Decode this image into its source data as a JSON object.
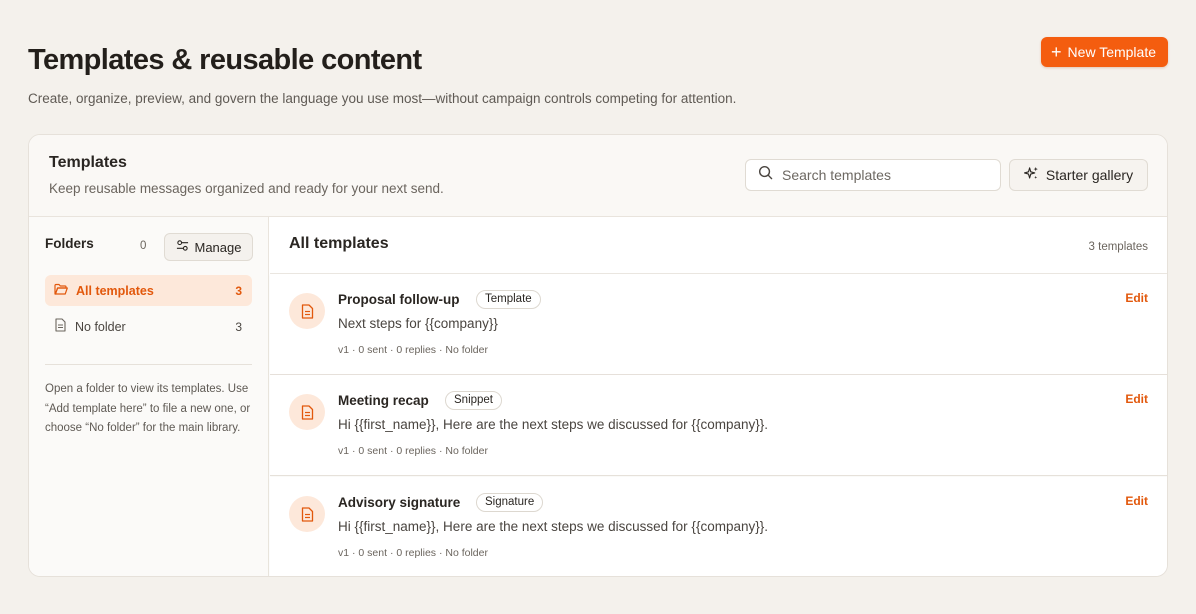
{
  "header": {
    "title": "Templates & reusable content",
    "subtitle": "Create, organize, preview, and govern the language you use most—without campaign controls competing for attention.",
    "new_button": "New Template"
  },
  "card": {
    "title": "Templates",
    "description": "Keep reusable messages organized and ready for your next send.",
    "search_placeholder": "Search templates",
    "starter_gallery": "Starter gallery"
  },
  "sidebar": {
    "folders_label": "Folders",
    "folders_count": "0",
    "manage_label": "Manage",
    "items": [
      {
        "label": "All templates",
        "count": "3",
        "active": true,
        "icon": "folder-open-icon"
      },
      {
        "label": "No folder",
        "count": "3",
        "active": false,
        "icon": "document-icon"
      }
    ],
    "help_text": "Open a folder to view its templates. Use “Add template here” to file a new one, or choose “No folder” for the main library."
  },
  "main": {
    "title": "All templates",
    "count_label": "3 templates",
    "templates": [
      {
        "name": "Proposal follow-up",
        "type": "Template",
        "preview": "Next steps for {{company}}",
        "meta": "v1 · 0 sent · 0 replies · No folder",
        "edit_label": "Edit"
      },
      {
        "name": "Meeting recap",
        "type": "Snippet",
        "preview": "Hi {{first_name}}, Here are the next steps we discussed for {{company}}.",
        "meta": "v1 · 0 sent · 0 replies · No folder",
        "edit_label": "Edit"
      },
      {
        "name": "Advisory signature",
        "type": "Signature",
        "preview": "Hi {{first_name}}, Here are the next steps we discussed for {{company}}.",
        "meta": "v1 · 0 sent · 0 replies · No folder",
        "edit_label": "Edit"
      }
    ]
  },
  "colors": {
    "accent": "#f45d0f",
    "accent_text": "#e2580c",
    "accent_soft": "#fde8da",
    "background": "#f4f1ec"
  }
}
